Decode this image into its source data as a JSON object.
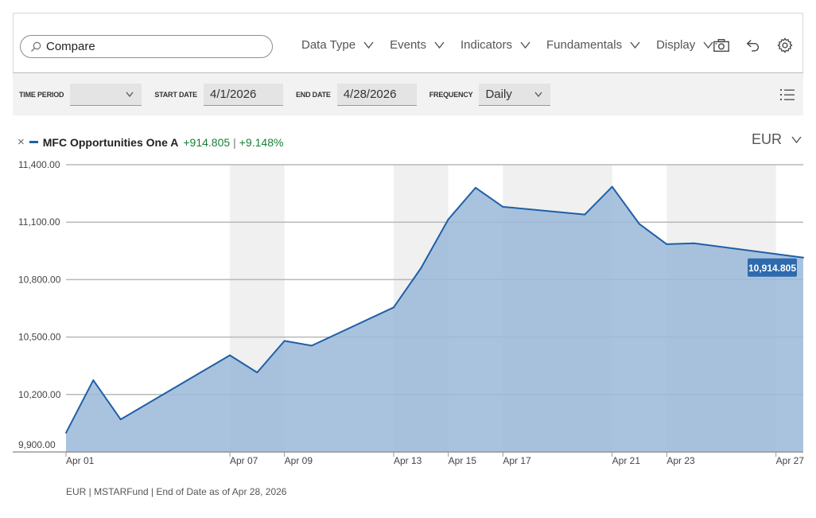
{
  "toolbar": {
    "search_placeholder": "Compare",
    "menus": [
      "Data Type",
      "Events",
      "Indicators",
      "Fundamentals",
      "Display"
    ],
    "tools": [
      "camera-icon",
      "undo-icon",
      "gear-icon"
    ]
  },
  "settings": {
    "time_period_label": "TIME PERIOD",
    "time_period_value": "",
    "start_date_label": "START DATE",
    "start_date_value": "4/1/2026",
    "end_date_label": "END DATE",
    "end_date_value": "4/28/2026",
    "frequency_label": "FREQUENCY",
    "frequency_value": "Daily"
  },
  "legend": {
    "series_name": "MFC Opportunities One A",
    "change_abs": "+914.805",
    "separator": "|",
    "change_pct": "+9.148%"
  },
  "currency": "EUR",
  "colors": {
    "line": "#1f5fa6",
    "area": "#9ab9d9",
    "band": "#f0f0f0",
    "change": "#1a7f37",
    "last_label_bg": "#2e6aad"
  },
  "chart_data": {
    "type": "area",
    "x": [
      "2026-04-01",
      "2026-04-02",
      "2026-04-03",
      "2026-04-06",
      "2026-04-07",
      "2026-04-08",
      "2026-04-09",
      "2026-04-10",
      "2026-04-13",
      "2026-04-14",
      "2026-04-15",
      "2026-04-16",
      "2026-04-17",
      "2026-04-20",
      "2026-04-21",
      "2026-04-22",
      "2026-04-23",
      "2026-04-24",
      "2026-04-27",
      "2026-04-28"
    ],
    "series": [
      {
        "values": [
          10000,
          10275,
          10070,
          10405,
          10315,
          10480,
          10455,
          10655,
          10860,
          11115,
          11280,
          11180,
          11140,
          11285,
          11090,
          10985,
          10990,
          10914.805
        ]
      }
    ],
    "plot_dates": [
      "2026-04-01",
      "2026-04-02",
      "2026-04-03",
      "2026-04-07",
      "2026-04-08",
      "2026-04-09",
      "2026-04-10",
      "2026-04-13",
      "2026-04-14",
      "2026-04-15",
      "2026-04-16",
      "2026-04-17",
      "2026-04-20",
      "2026-04-21",
      "2026-04-22",
      "2026-04-23",
      "2026-04-24",
      "2026-04-28"
    ],
    "xticks": [
      "Apr 01",
      "Apr 07",
      "Apr 09",
      "Apr 13",
      "Apr 15",
      "Apr 17",
      "Apr 21",
      "Apr 23",
      "Apr 27"
    ],
    "yticks": [
      "11,400.00",
      "11,100.00",
      "10,800.00",
      "10,500.00",
      "10,200.00",
      "9,900.00"
    ],
    "ytick_values": [
      11400,
      11100,
      10800,
      10500,
      10200,
      9900
    ],
    "ylim": [
      9900,
      11400
    ],
    "last_value_label": "10,914.805",
    "grid": true,
    "legend_position": "top-left"
  },
  "footer": "EUR | MSTARFund | End of Date as of Apr 28, 2026"
}
